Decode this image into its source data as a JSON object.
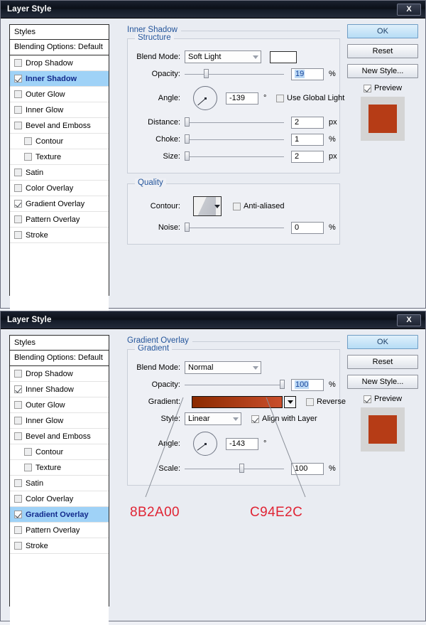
{
  "dialogs": [
    {
      "id": "inner-shadow",
      "title": "Layer Style",
      "close_label": "X",
      "styles_panel": {
        "header": "Styles",
        "blending_options": "Blending Options: Default",
        "items": [
          {
            "label": "Drop Shadow",
            "checked": false,
            "indent": false,
            "selected": false
          },
          {
            "label": "Inner Shadow",
            "checked": true,
            "indent": false,
            "selected": true
          },
          {
            "label": "Outer Glow",
            "checked": false,
            "indent": false,
            "selected": false
          },
          {
            "label": "Inner Glow",
            "checked": false,
            "indent": false,
            "selected": false
          },
          {
            "label": "Bevel and Emboss",
            "checked": false,
            "indent": false,
            "selected": false
          },
          {
            "label": "Contour",
            "checked": false,
            "indent": true,
            "selected": false
          },
          {
            "label": "Texture",
            "checked": false,
            "indent": true,
            "selected": false
          },
          {
            "label": "Satin",
            "checked": false,
            "indent": false,
            "selected": false
          },
          {
            "label": "Color Overlay",
            "checked": false,
            "indent": false,
            "selected": false
          },
          {
            "label": "Gradient Overlay",
            "checked": true,
            "indent": false,
            "selected": false
          },
          {
            "label": "Pattern Overlay",
            "checked": false,
            "indent": false,
            "selected": false
          },
          {
            "label": "Stroke",
            "checked": false,
            "indent": false,
            "selected": false
          }
        ]
      },
      "section_title": "Inner Shadow",
      "structure": {
        "legend": "Structure",
        "blend_mode_label": "Blend Mode:",
        "blend_mode_value": "Soft Light",
        "blend_color": "#ffffff",
        "opacity_label": "Opacity:",
        "opacity_value": "19",
        "opacity_unit": "%",
        "angle_label": "Angle:",
        "angle_value": "-139",
        "angle_unit": "°",
        "use_global_light": "Use Global Light",
        "use_global_light_checked": false,
        "distance_label": "Distance:",
        "distance_value": "2",
        "distance_unit": "px",
        "choke_label": "Choke:",
        "choke_value": "1",
        "choke_unit": "%",
        "size_label": "Size:",
        "size_value": "2",
        "size_unit": "px"
      },
      "quality": {
        "legend": "Quality",
        "contour_label": "Contour:",
        "anti_aliased_label": "Anti-aliased",
        "anti_aliased_checked": false,
        "noise_label": "Noise:",
        "noise_value": "0",
        "noise_unit": "%"
      },
      "buttons": {
        "ok": "OK",
        "reset": "Reset",
        "new_style": "New Style...",
        "preview": "Preview",
        "preview_checked": true,
        "preview_swatch_color": "#b63c16"
      }
    },
    {
      "id": "gradient-overlay",
      "title": "Layer Style",
      "close_label": "X",
      "styles_panel": {
        "header": "Styles",
        "blending_options": "Blending Options: Default",
        "items": [
          {
            "label": "Drop Shadow",
            "checked": false,
            "indent": false,
            "selected": false
          },
          {
            "label": "Inner Shadow",
            "checked": true,
            "indent": false,
            "selected": false
          },
          {
            "label": "Outer Glow",
            "checked": false,
            "indent": false,
            "selected": false
          },
          {
            "label": "Inner Glow",
            "checked": false,
            "indent": false,
            "selected": false
          },
          {
            "label": "Bevel and Emboss",
            "checked": false,
            "indent": false,
            "selected": false
          },
          {
            "label": "Contour",
            "checked": false,
            "indent": true,
            "selected": false
          },
          {
            "label": "Texture",
            "checked": false,
            "indent": true,
            "selected": false
          },
          {
            "label": "Satin",
            "checked": false,
            "indent": false,
            "selected": false
          },
          {
            "label": "Color Overlay",
            "checked": false,
            "indent": false,
            "selected": false
          },
          {
            "label": "Gradient Overlay",
            "checked": true,
            "indent": false,
            "selected": true
          },
          {
            "label": "Pattern Overlay",
            "checked": false,
            "indent": false,
            "selected": false
          },
          {
            "label": "Stroke",
            "checked": false,
            "indent": false,
            "selected": false
          }
        ]
      },
      "section_title": "Gradient Overlay",
      "gradient": {
        "legend": "Gradient",
        "blend_mode_label": "Blend Mode:",
        "blend_mode_value": "Normal",
        "opacity_label": "Opacity:",
        "opacity_value": "100",
        "opacity_unit": "%",
        "gradient_label": "Gradient:",
        "gradient_start": "#8B2A00",
        "gradient_end": "#C94E2C",
        "reverse_label": "Reverse",
        "reverse_checked": false,
        "style_label": "Style:",
        "style_value": "Linear",
        "align_label": "Align with Layer",
        "align_checked": true,
        "angle_label": "Angle:",
        "angle_value": "-143",
        "angle_unit": "°",
        "scale_label": "Scale:",
        "scale_value": "100",
        "scale_unit": "%"
      },
      "buttons": {
        "ok": "OK",
        "reset": "Reset",
        "new_style": "New Style...",
        "preview": "Preview",
        "preview_checked": true,
        "preview_swatch_color": "#b63c16"
      }
    }
  ],
  "annotations": {
    "color": "#e02434",
    "left_hex": "8B2A00",
    "right_hex": "C94E2C"
  }
}
